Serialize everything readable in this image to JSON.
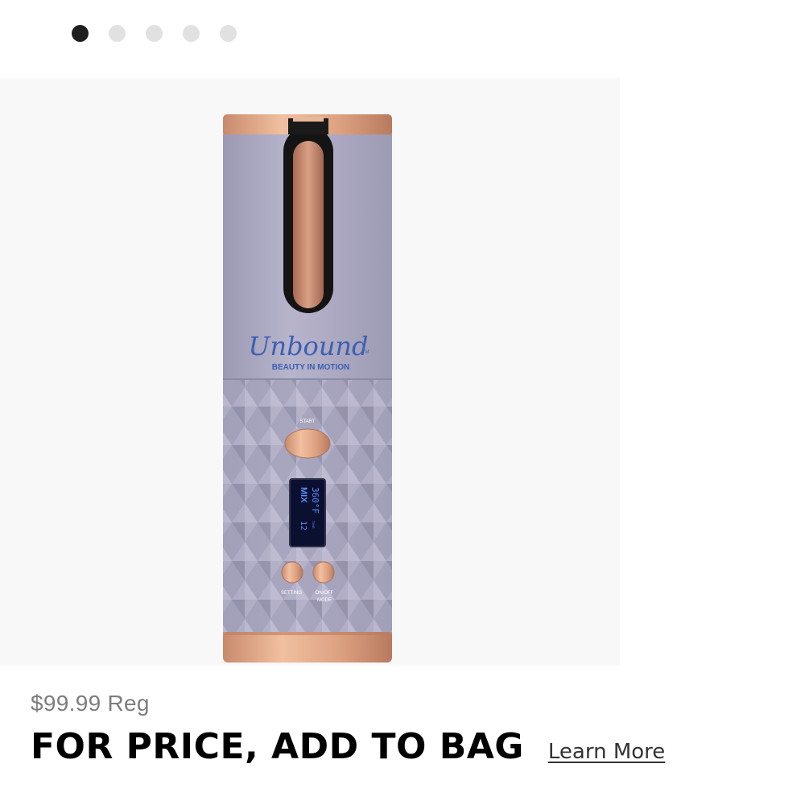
{
  "carousel": {
    "total": 5,
    "active_index": 0
  },
  "product_image": {
    "brand": "Unbound",
    "brand_tm": "TM",
    "tagline": "BEAUTY IN MOTION",
    "start_label": "START",
    "lcd_temp": "360°F",
    "lcd_mode": "MIX",
    "lcd_time_label": "TIME",
    "lcd_time": "12",
    "setting_label": "SETTING",
    "onoff_label_1": "ON/OFF",
    "onoff_label_2": "MODE"
  },
  "pricing": {
    "reg_price": "$99.99 Reg",
    "cta_text": "FOR PRICE, ADD TO BAG",
    "learn_more": "Learn More"
  },
  "colors": {
    "body_lavender": "#a9a6c0",
    "rose_gold": "#d9a080",
    "lcd_bg": "#0b1030",
    "lcd_text": "#5b8cff",
    "brand_blue": "#3d5fb3"
  }
}
